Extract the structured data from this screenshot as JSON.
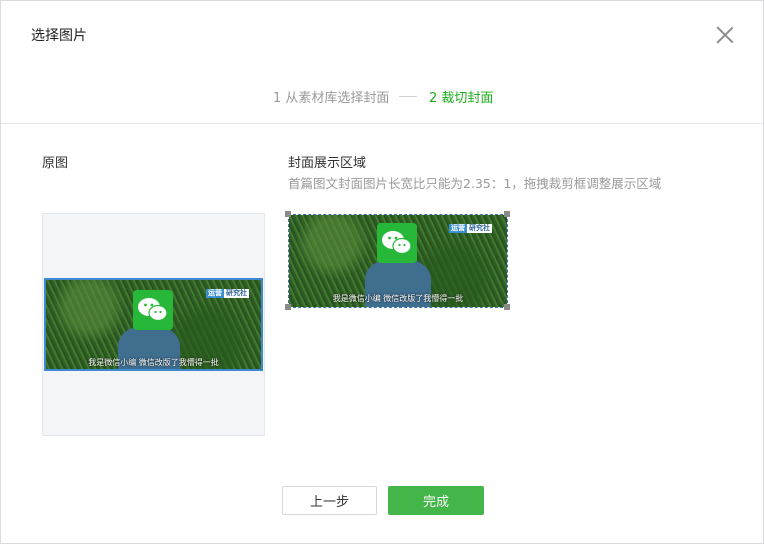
{
  "dialog": {
    "title": "选择图片",
    "close_icon": "close-icon"
  },
  "steps": {
    "step1": "1 从素材库选择封面",
    "step2": "2 裁切封面",
    "active_color": "#1aad19",
    "inactive_color": "#9a9a9a"
  },
  "original": {
    "label": "原图"
  },
  "preview": {
    "label": "封面展示区域",
    "tip": "首篇图文封面图片长宽比只能为2.35：1，拖拽裁剪框调整展示区域"
  },
  "image": {
    "tag_a": "运营",
    "tag_b": "研究社",
    "caption": "我是微信小编  微信改版了我懵得一批",
    "logo_icon": "wechat-icon"
  },
  "buttons": {
    "prev": "上一步",
    "done": "完成",
    "done_color": "#44b549"
  }
}
